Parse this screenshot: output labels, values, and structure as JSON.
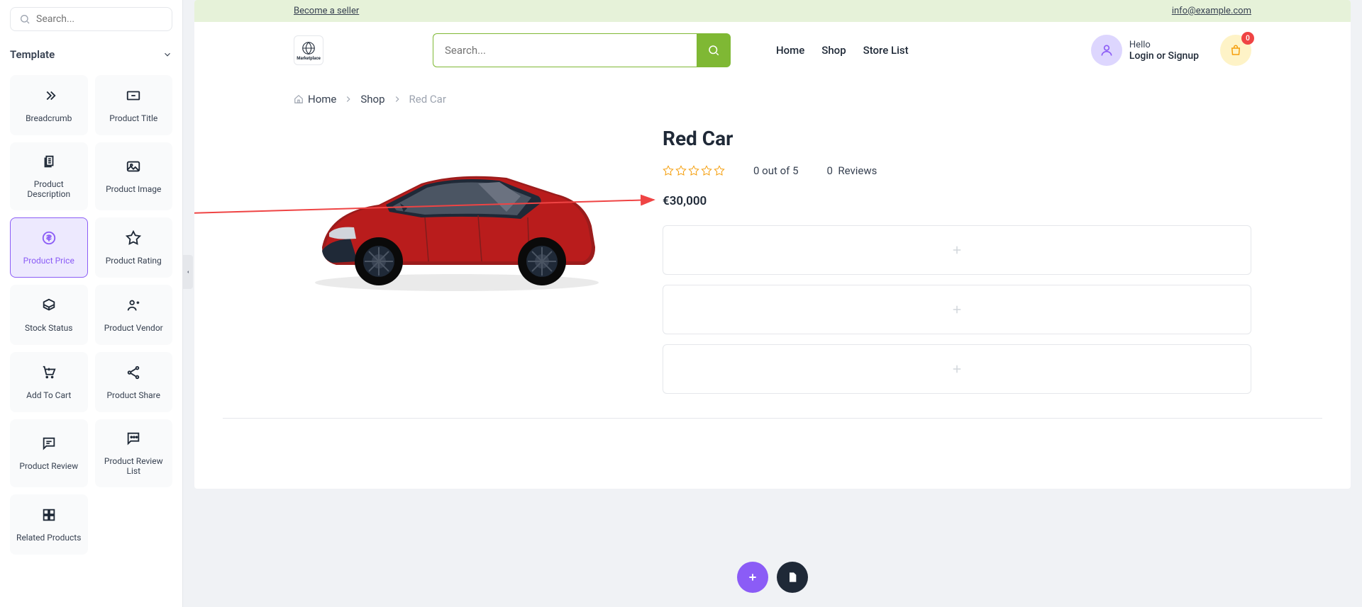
{
  "sidebar": {
    "search_placeholder": "Search...",
    "section_title": "Template",
    "cards": [
      {
        "label": "Breadcrumb"
      },
      {
        "label": "Product Title"
      },
      {
        "label": "Product Description"
      },
      {
        "label": "Product Image"
      },
      {
        "label": "Product Price"
      },
      {
        "label": "Product Rating"
      },
      {
        "label": "Stock Status"
      },
      {
        "label": "Product Vendor"
      },
      {
        "label": "Add To Cart"
      },
      {
        "label": "Product Share"
      },
      {
        "label": "Product Review"
      },
      {
        "label": "Product Review List"
      },
      {
        "label": "Related Products"
      }
    ]
  },
  "banner": {
    "seller_link": "Become a seller",
    "email": "info@example.com"
  },
  "header": {
    "logo_text": "Marketplace",
    "search_placeholder": "Search...",
    "nav": [
      "Home",
      "Shop",
      "Store List"
    ],
    "hello": "Hello",
    "login": "Login or Signup",
    "cart_count": "0"
  },
  "breadcrumb": {
    "items": [
      "Home",
      "Shop",
      "Red Car"
    ]
  },
  "product": {
    "title": "Red Car",
    "rating_text": "0 out of 5",
    "reviews_count": "0",
    "reviews_label": "Reviews",
    "price": "€30,000"
  }
}
